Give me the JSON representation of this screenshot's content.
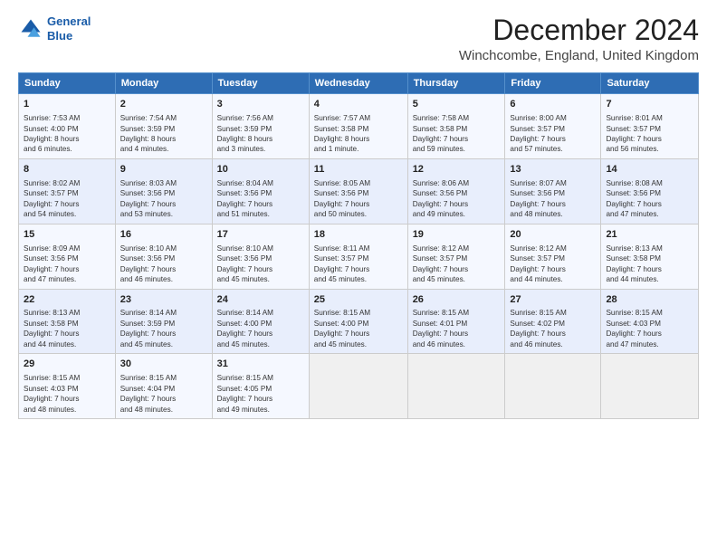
{
  "header": {
    "logo_line1": "General",
    "logo_line2": "Blue",
    "main_title": "December 2024",
    "subtitle": "Winchcombe, England, United Kingdom"
  },
  "calendar": {
    "days_of_week": [
      "Sunday",
      "Monday",
      "Tuesday",
      "Wednesday",
      "Thursday",
      "Friday",
      "Saturday"
    ],
    "weeks": [
      [
        {
          "day": "1",
          "info": "Sunrise: 7:53 AM\nSunset: 4:00 PM\nDaylight: 8 hours\nand 6 minutes."
        },
        {
          "day": "2",
          "info": "Sunrise: 7:54 AM\nSunset: 3:59 PM\nDaylight: 8 hours\nand 4 minutes."
        },
        {
          "day": "3",
          "info": "Sunrise: 7:56 AM\nSunset: 3:59 PM\nDaylight: 8 hours\nand 3 minutes."
        },
        {
          "day": "4",
          "info": "Sunrise: 7:57 AM\nSunset: 3:58 PM\nDaylight: 8 hours\nand 1 minute."
        },
        {
          "day": "5",
          "info": "Sunrise: 7:58 AM\nSunset: 3:58 PM\nDaylight: 7 hours\nand 59 minutes."
        },
        {
          "day": "6",
          "info": "Sunrise: 8:00 AM\nSunset: 3:57 PM\nDaylight: 7 hours\nand 57 minutes."
        },
        {
          "day": "7",
          "info": "Sunrise: 8:01 AM\nSunset: 3:57 PM\nDaylight: 7 hours\nand 56 minutes."
        }
      ],
      [
        {
          "day": "8",
          "info": "Sunrise: 8:02 AM\nSunset: 3:57 PM\nDaylight: 7 hours\nand 54 minutes."
        },
        {
          "day": "9",
          "info": "Sunrise: 8:03 AM\nSunset: 3:56 PM\nDaylight: 7 hours\nand 53 minutes."
        },
        {
          "day": "10",
          "info": "Sunrise: 8:04 AM\nSunset: 3:56 PM\nDaylight: 7 hours\nand 51 minutes."
        },
        {
          "day": "11",
          "info": "Sunrise: 8:05 AM\nSunset: 3:56 PM\nDaylight: 7 hours\nand 50 minutes."
        },
        {
          "day": "12",
          "info": "Sunrise: 8:06 AM\nSunset: 3:56 PM\nDaylight: 7 hours\nand 49 minutes."
        },
        {
          "day": "13",
          "info": "Sunrise: 8:07 AM\nSunset: 3:56 PM\nDaylight: 7 hours\nand 48 minutes."
        },
        {
          "day": "14",
          "info": "Sunrise: 8:08 AM\nSunset: 3:56 PM\nDaylight: 7 hours\nand 47 minutes."
        }
      ],
      [
        {
          "day": "15",
          "info": "Sunrise: 8:09 AM\nSunset: 3:56 PM\nDaylight: 7 hours\nand 47 minutes."
        },
        {
          "day": "16",
          "info": "Sunrise: 8:10 AM\nSunset: 3:56 PM\nDaylight: 7 hours\nand 46 minutes."
        },
        {
          "day": "17",
          "info": "Sunrise: 8:10 AM\nSunset: 3:56 PM\nDaylight: 7 hours\nand 45 minutes."
        },
        {
          "day": "18",
          "info": "Sunrise: 8:11 AM\nSunset: 3:57 PM\nDaylight: 7 hours\nand 45 minutes."
        },
        {
          "day": "19",
          "info": "Sunrise: 8:12 AM\nSunset: 3:57 PM\nDaylight: 7 hours\nand 45 minutes."
        },
        {
          "day": "20",
          "info": "Sunrise: 8:12 AM\nSunset: 3:57 PM\nDaylight: 7 hours\nand 44 minutes."
        },
        {
          "day": "21",
          "info": "Sunrise: 8:13 AM\nSunset: 3:58 PM\nDaylight: 7 hours\nand 44 minutes."
        }
      ],
      [
        {
          "day": "22",
          "info": "Sunrise: 8:13 AM\nSunset: 3:58 PM\nDaylight: 7 hours\nand 44 minutes."
        },
        {
          "day": "23",
          "info": "Sunrise: 8:14 AM\nSunset: 3:59 PM\nDaylight: 7 hours\nand 45 minutes."
        },
        {
          "day": "24",
          "info": "Sunrise: 8:14 AM\nSunset: 4:00 PM\nDaylight: 7 hours\nand 45 minutes."
        },
        {
          "day": "25",
          "info": "Sunrise: 8:15 AM\nSunset: 4:00 PM\nDaylight: 7 hours\nand 45 minutes."
        },
        {
          "day": "26",
          "info": "Sunrise: 8:15 AM\nSunset: 4:01 PM\nDaylight: 7 hours\nand 46 minutes."
        },
        {
          "day": "27",
          "info": "Sunrise: 8:15 AM\nSunset: 4:02 PM\nDaylight: 7 hours\nand 46 minutes."
        },
        {
          "day": "28",
          "info": "Sunrise: 8:15 AM\nSunset: 4:03 PM\nDaylight: 7 hours\nand 47 minutes."
        }
      ],
      [
        {
          "day": "29",
          "info": "Sunrise: 8:15 AM\nSunset: 4:03 PM\nDaylight: 7 hours\nand 48 minutes."
        },
        {
          "day": "30",
          "info": "Sunrise: 8:15 AM\nSunset: 4:04 PM\nDaylight: 7 hours\nand 48 minutes."
        },
        {
          "day": "31",
          "info": "Sunrise: 8:15 AM\nSunset: 4:05 PM\nDaylight: 7 hours\nand 49 minutes."
        },
        {
          "day": "",
          "info": ""
        },
        {
          "day": "",
          "info": ""
        },
        {
          "day": "",
          "info": ""
        },
        {
          "day": "",
          "info": ""
        }
      ]
    ]
  }
}
